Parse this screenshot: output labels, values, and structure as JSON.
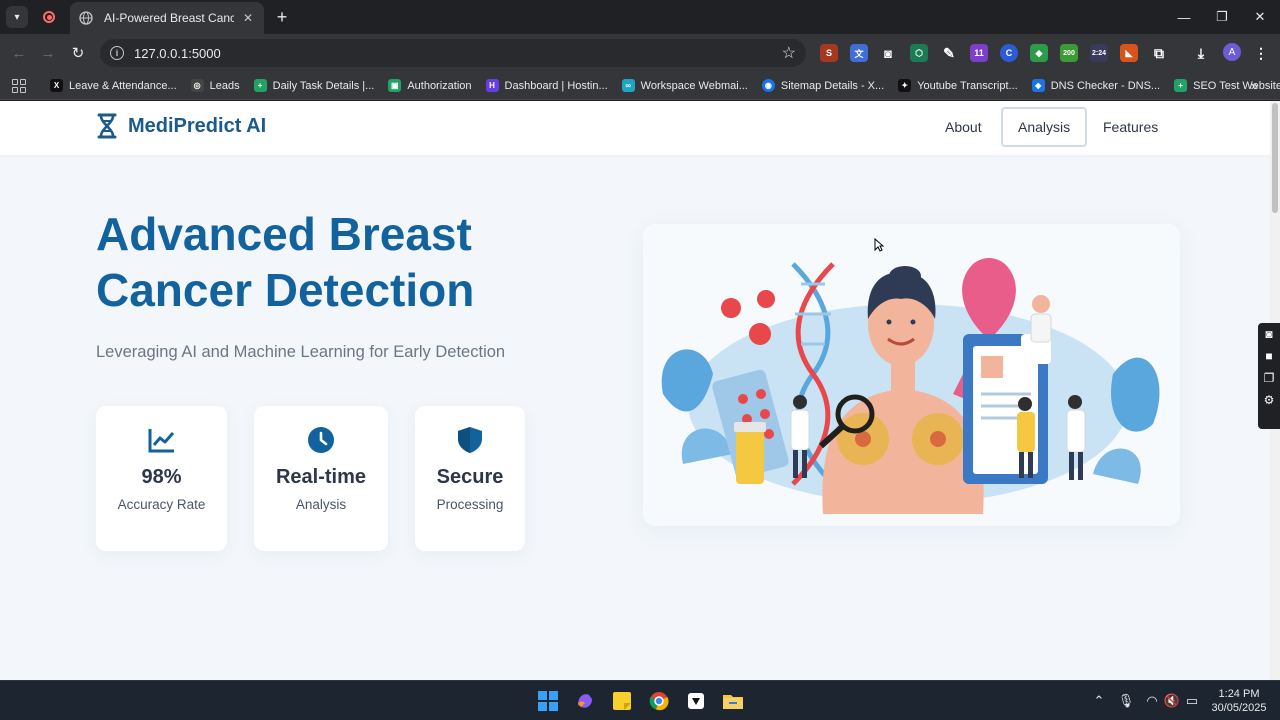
{
  "browser": {
    "tab_title": "AI-Powered Breast Cancer Dete",
    "url": "127.0.0.1:5000",
    "bookmarks": [
      {
        "label": "Leave & Attendance...",
        "color": "#111111",
        "glyph": "X"
      },
      {
        "label": "Leads",
        "color": "#444444",
        "glyph": "◎"
      },
      {
        "label": "Daily Task Details |...",
        "color": "#21a366",
        "glyph": "+"
      },
      {
        "label": "Authorization",
        "color": "#21a366",
        "glyph": "▣"
      },
      {
        "label": "Dashboard | Hostin...",
        "color": "#673de6",
        "glyph": "H"
      },
      {
        "label": "Workspace Webmai...",
        "color": "#1fa5c4",
        "glyph": "∞"
      },
      {
        "label": "Sitemap Details - X...",
        "color": "#1a73e8",
        "glyph": "◉"
      },
      {
        "label": "Youtube Transcript...",
        "color": "#111111",
        "glyph": "✦"
      },
      {
        "label": "DNS Checker - DNS...",
        "color": "#1a73e8",
        "glyph": "◈"
      },
      {
        "label": "SEO Test Website C...",
        "color": "#21a366",
        "glyph": "+"
      }
    ],
    "ext_badges": {
      "badge_11": "11",
      "badge_200": "200",
      "badge_time": "2:24"
    },
    "profile_initial": "A"
  },
  "site": {
    "brand": "MediPredict AI",
    "nav": {
      "about": "About",
      "analysis": "Analysis",
      "features": "Features"
    },
    "hero_title": "Advanced Breast Cancer Detection",
    "hero_subtitle": "Leveraging AI and Machine Learning for Early Detection",
    "cards": [
      {
        "value": "98%",
        "label": "Accuracy Rate",
        "icon": "chart-line-icon"
      },
      {
        "value": "Real-time",
        "label": "Analysis",
        "icon": "clock-icon"
      },
      {
        "value": "Secure",
        "label": "Processing",
        "icon": "shield-icon"
      }
    ],
    "accent_color": "#12629e"
  },
  "taskbar": {
    "time": "1:24 PM",
    "date": "30/05/2025"
  }
}
